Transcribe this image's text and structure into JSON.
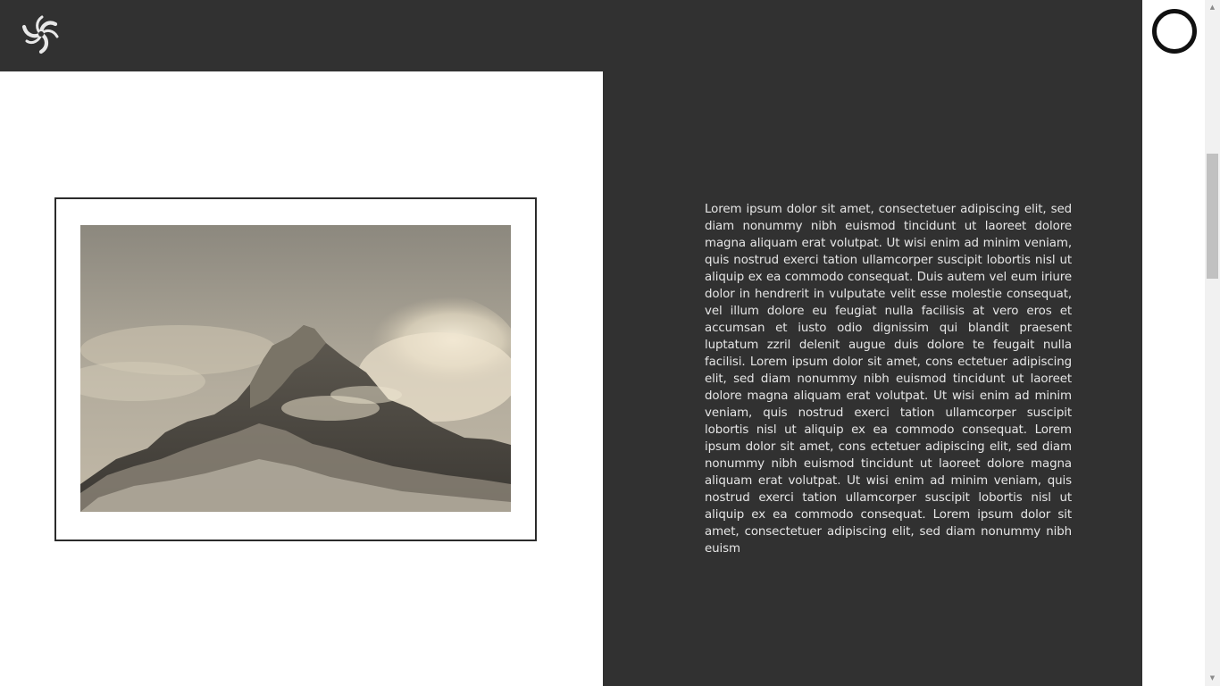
{
  "header": {
    "logo_icon": "swirl-logo-icon"
  },
  "menu": {
    "icon": "circle-menu-icon"
  },
  "hero_image": {
    "alt": "Snow-capped mountain peak with clouds"
  },
  "content": {
    "paragraph": "Lorem ipsum dolor sit amet, consectetuer adipiscing elit, sed diam nonummy nibh euismod tincidunt ut laoreet dolore magna aliquam erat volutpat. Ut wisi enim ad minim veniam, quis nostrud exerci tation ullamcorper suscipit lobortis nisl ut aliquip ex ea commodo consequat. Duis autem vel eum iriure dolor in hendrerit in vulputate velit esse molestie consequat, vel illum dolore eu feugiat nulla facilisis at vero eros et accumsan et iusto odio dignissim qui blandit praesent luptatum zzril delenit augue duis dolore te feugait nulla facilisi. Lorem ipsum dolor sit amet, cons ectetuer adipiscing elit, sed diam nonummy nibh euismod tincidunt ut laoreet dolore magna aliquam erat volutpat. Ut wisi enim ad minim veniam, quis nostrud exerci tation ullamcorper suscipit lobortis nisl ut aliquip ex ea commodo consequat. Lorem ipsum dolor sit amet, cons ectetuer adipiscing elit, sed diam nonummy nibh euismod tincidunt ut laoreet dolore magna aliquam erat volutpat. Ut wisi enim ad minim veniam, quis nostrud exerci tation ullamcorper suscipit lobortis nisl ut aliquip ex ea commodo consequat. Lorem ipsum dolor sit amet, consectetuer adipiscing elit, sed diam nonummy nibh euism"
  },
  "colors": {
    "dark_panel": "#313131",
    "text": "#e6e6e6",
    "frame_border": "#2b2b2b",
    "background": "#ffffff"
  }
}
